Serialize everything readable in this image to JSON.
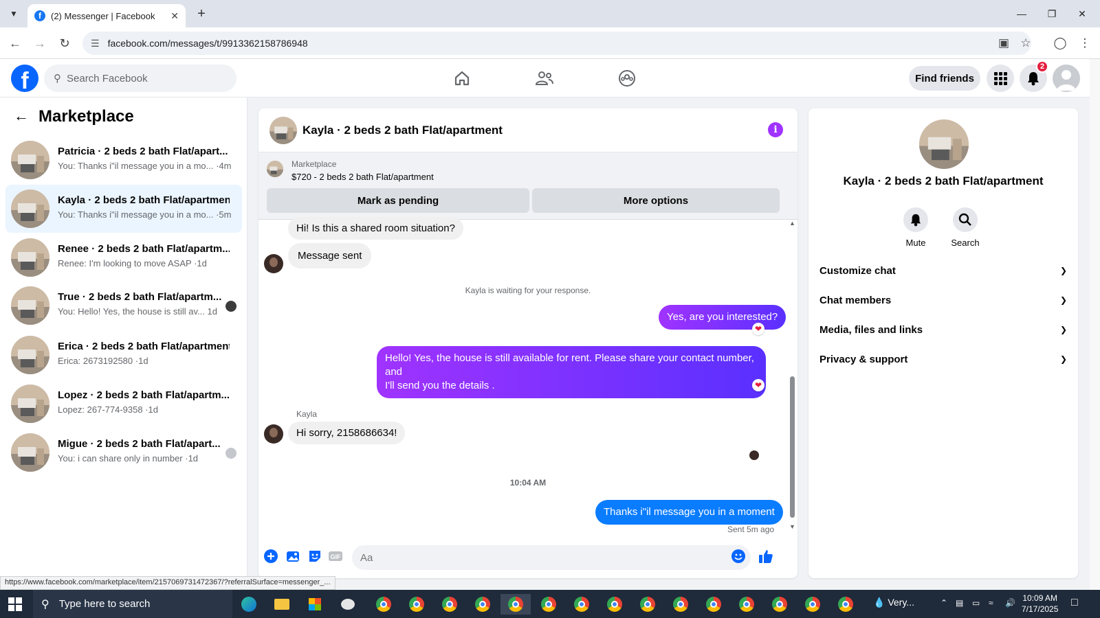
{
  "browser": {
    "tab_title": "(2) Messenger | Facebook",
    "url": "facebook.com/messages/t/9913362158786948",
    "status_url": "https://www.facebook.com/marketplace/item/2157069731472367/?referralSurface=messenger_..."
  },
  "fb_nav": {
    "search_placeholder": "Search Facebook",
    "find_friends": "Find friends",
    "notification_count": "2"
  },
  "sidebar": {
    "title": "Marketplace",
    "conversations": [
      {
        "name": "Patricia · 2 beds 2 bath Flat/apart...",
        "preview": "You: Thanks i\"il message you in a mo... ·4m"
      },
      {
        "name": "Kayla · 2 beds 2 bath Flat/apartment",
        "preview": "You: Thanks i\"il message you in a mo... ·5m"
      },
      {
        "name": "Renee · 2 beds 2 bath Flat/apartm...",
        "preview": "Renee: I'm looking to move ASAP ·1d"
      },
      {
        "name": "True · 2 beds 2 bath Flat/apartm...",
        "preview": "You: Hello! Yes, the house is still av...   1d"
      },
      {
        "name": "Erica · 2 beds 2 bath Flat/apartment",
        "preview": "Erica: 2673192580 ·1d"
      },
      {
        "name": "Lopez · 2 beds 2 bath Flat/apartm...",
        "preview": "Lopez: 267-774-9358 ·1d"
      },
      {
        "name": "Migue · 2 beds 2 bath Flat/apart...",
        "preview": "You: i can share only in number ·1d"
      }
    ]
  },
  "chat": {
    "title": "Kayla · 2 beds 2 bath Flat/apartment",
    "listing_category": "Marketplace",
    "listing": "$720 - 2 beds 2 bath Flat/apartment",
    "mark_pending": "Mark as pending",
    "more_options": "More options",
    "messages": {
      "m1": "Hi! Is this a shared room situation?",
      "m2": "Message sent",
      "waiting": "Kayla is waiting for your response.",
      "m3": "Yes, are you interested?",
      "m4_line1": "Hello! Yes, the house is still available for rent. Please share your contact number, and",
      "m4_line2": "I'll send you the details .",
      "sender": "Kayla",
      "m5": "Hi sorry, 2158686634!",
      "time": "10:04 AM",
      "m6": "Thanks i\"il message you in a moment",
      "sent_ago": "Sent 5m ago"
    },
    "composer_placeholder": "Aa"
  },
  "info_panel": {
    "name": "Kayla · 2 beds 2 bath Flat/apartment",
    "actions": [
      "Mute",
      "Search"
    ],
    "sections": [
      "Customize chat",
      "Chat members",
      "Media, files and links",
      "Privacy & support"
    ]
  },
  "taskbar": {
    "search_placeholder": "Type here to search",
    "weather": "Very...",
    "time": "10:09 AM",
    "date": "7/17/2025"
  },
  "colors": {
    "facebook_blue": "#0866ff",
    "outgoing_gradient_start": "#a033ff",
    "outgoing_gradient_end": "#5a30ff",
    "outgoing_blue": "#0a7cff",
    "badge_red": "#e41e3f"
  }
}
